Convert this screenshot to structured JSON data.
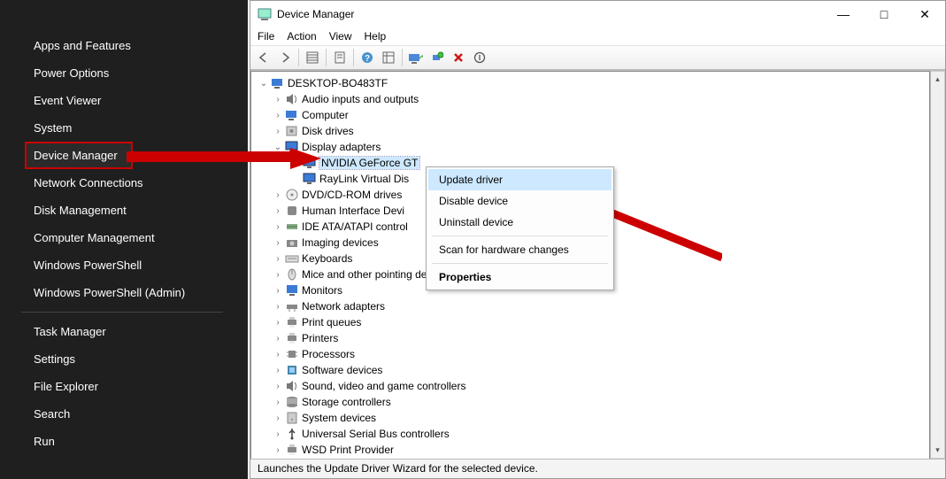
{
  "winx_menu": {
    "groups": [
      [
        "Apps and Features",
        "Power Options",
        "Event Viewer",
        "System",
        "Device Manager",
        "Network Connections",
        "Disk Management",
        "Computer Management",
        "Windows PowerShell",
        "Windows PowerShell (Admin)"
      ],
      [
        "Task Manager",
        "Settings",
        "File Explorer",
        "Search",
        "Run"
      ]
    ],
    "highlighted": "Device Manager"
  },
  "device_manager": {
    "title": "Device Manager",
    "menubar": [
      "File",
      "Action",
      "View",
      "Help"
    ],
    "status": "Launches the Update Driver Wizard for the selected device.",
    "root": "DESKTOP-BO483TF",
    "categories": [
      {
        "label": "Audio inputs and outputs",
        "expanded": false,
        "icon": "speaker-icon"
      },
      {
        "label": "Computer",
        "expanded": false,
        "icon": "computer-icon"
      },
      {
        "label": "Disk drives",
        "expanded": false,
        "icon": "disk-icon"
      },
      {
        "label": "Display adapters",
        "expanded": true,
        "icon": "display-icon",
        "children": [
          {
            "label": "NVIDIA GeForce GT",
            "icon": "display-icon",
            "selected": true
          },
          {
            "label": "RayLink Virtual Dis",
            "icon": "display-icon"
          }
        ]
      },
      {
        "label": "DVD/CD-ROM drives",
        "expanded": false,
        "icon": "cd-icon"
      },
      {
        "label": "Human Interface Devi",
        "expanded": false,
        "icon": "hid-icon"
      },
      {
        "label": "IDE ATA/ATAPI control",
        "expanded": false,
        "icon": "ide-icon"
      },
      {
        "label": "Imaging devices",
        "expanded": false,
        "icon": "camera-icon"
      },
      {
        "label": "Keyboards",
        "expanded": false,
        "icon": "keyboard-icon"
      },
      {
        "label": "Mice and other pointing devices",
        "expanded": false,
        "icon": "mouse-icon"
      },
      {
        "label": "Monitors",
        "expanded": false,
        "icon": "monitor-icon"
      },
      {
        "label": "Network adapters",
        "expanded": false,
        "icon": "network-icon"
      },
      {
        "label": "Print queues",
        "expanded": false,
        "icon": "printer-icon"
      },
      {
        "label": "Printers",
        "expanded": false,
        "icon": "printer-icon"
      },
      {
        "label": "Processors",
        "expanded": false,
        "icon": "cpu-icon"
      },
      {
        "label": "Software devices",
        "expanded": false,
        "icon": "software-icon"
      },
      {
        "label": "Sound, video and game controllers",
        "expanded": false,
        "icon": "speaker-icon"
      },
      {
        "label": "Storage controllers",
        "expanded": false,
        "icon": "storage-icon"
      },
      {
        "label": "System devices",
        "expanded": false,
        "icon": "system-icon"
      },
      {
        "label": "Universal Serial Bus controllers",
        "expanded": false,
        "icon": "usb-icon"
      },
      {
        "label": "WSD Print Provider",
        "expanded": false,
        "icon": "printer-icon",
        "truncated": true
      }
    ],
    "context_menu": {
      "items": [
        {
          "label": "Update driver",
          "hover": true
        },
        {
          "label": "Disable device"
        },
        {
          "label": "Uninstall device"
        },
        {
          "sep": true
        },
        {
          "label": "Scan for hardware changes"
        },
        {
          "sep": true
        },
        {
          "label": "Properties",
          "bold": true
        }
      ]
    }
  }
}
